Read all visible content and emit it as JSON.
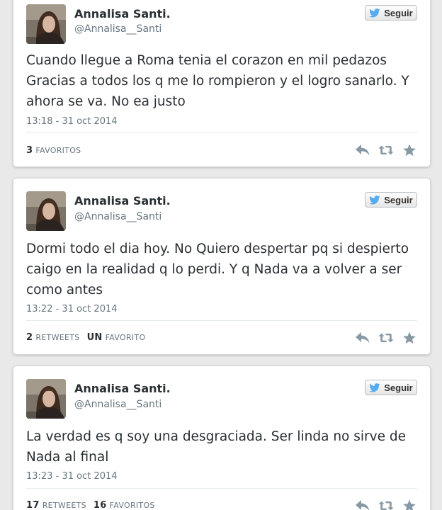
{
  "follow_label": "Seguir",
  "colors": {
    "twitter_blue": "#55acee",
    "icon_gray": "#8899a6"
  },
  "tweets": [
    {
      "name": "Annalisa Santi.",
      "handle": "@Annalisa__Santi",
      "text": "Cuando llegue a Roma tenia el corazon en mil pedazos Gracias a todos los q me lo rompieron y el logro sanarlo. Y ahora se va. No ea justo",
      "timestamp": "13:18 - 31 oct 2014",
      "favorites_count": "3",
      "favorites_label": "FAVORITOS"
    },
    {
      "name": "Annalisa Santi.",
      "handle": "@Annalisa__Santi",
      "text": "Dormi todo el dia hoy. No Quiero despertar pq si despierto caigo en la realidad q lo perdi. Y q Nada va a volver a ser como antes",
      "timestamp": "13:22 - 31 oct 2014",
      "retweets_count": "2",
      "retweets_label": "RETWEETS",
      "favorites_count": "UN",
      "favorites_label": "FAVORITO"
    },
    {
      "name": "Annalisa Santi.",
      "handle": "@Annalisa__Santi",
      "text": "La verdad es q soy una desgraciada. Ser linda no sirve de Nada al final",
      "timestamp": "13:23 - 31 oct 2014",
      "retweets_count": "17",
      "retweets_label": "RETWEETS",
      "favorites_count": "16",
      "favorites_label": "FAVORITOS"
    }
  ]
}
